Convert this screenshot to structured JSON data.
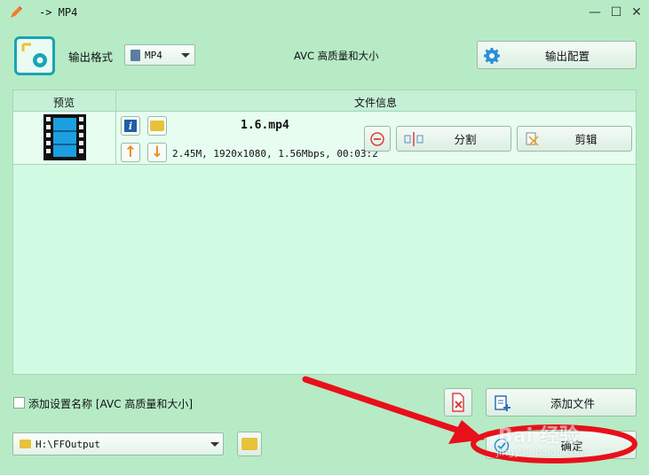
{
  "window": {
    "title": "-> MP4",
    "minimize": "—",
    "maximize": "☐",
    "close": "✕"
  },
  "toolbar": {
    "output_format_label": "输出格式",
    "format_value": "MP4",
    "quality_text": "AVC 高质量和大小",
    "output_config_label": "输出配置"
  },
  "table": {
    "col_preview": "预览",
    "col_fileinfo": "文件信息"
  },
  "file": {
    "name": "1.6.mp4",
    "details": "2.45M, 1920x1080, 1.56Mbps, 00:03:2"
  },
  "row_actions": {
    "split_label": "分割",
    "cut_label": "剪辑"
  },
  "bottom": {
    "add_setting_label": "添加设置名称 [AVC 高质量和大小]",
    "add_file_label": "添加文件",
    "output_path": "H:\\FFOutput",
    "ok_label": "确定"
  },
  "overlay": {
    "watermark_main": "Bai 经验",
    "watermark_sub": "jingyan.baidu.com"
  },
  "colors": {
    "accent": "#19a3b5",
    "annotation_red": "#e8101a",
    "panel_bg": "#d2fbe4",
    "window_bg": "#b6ebc6"
  }
}
